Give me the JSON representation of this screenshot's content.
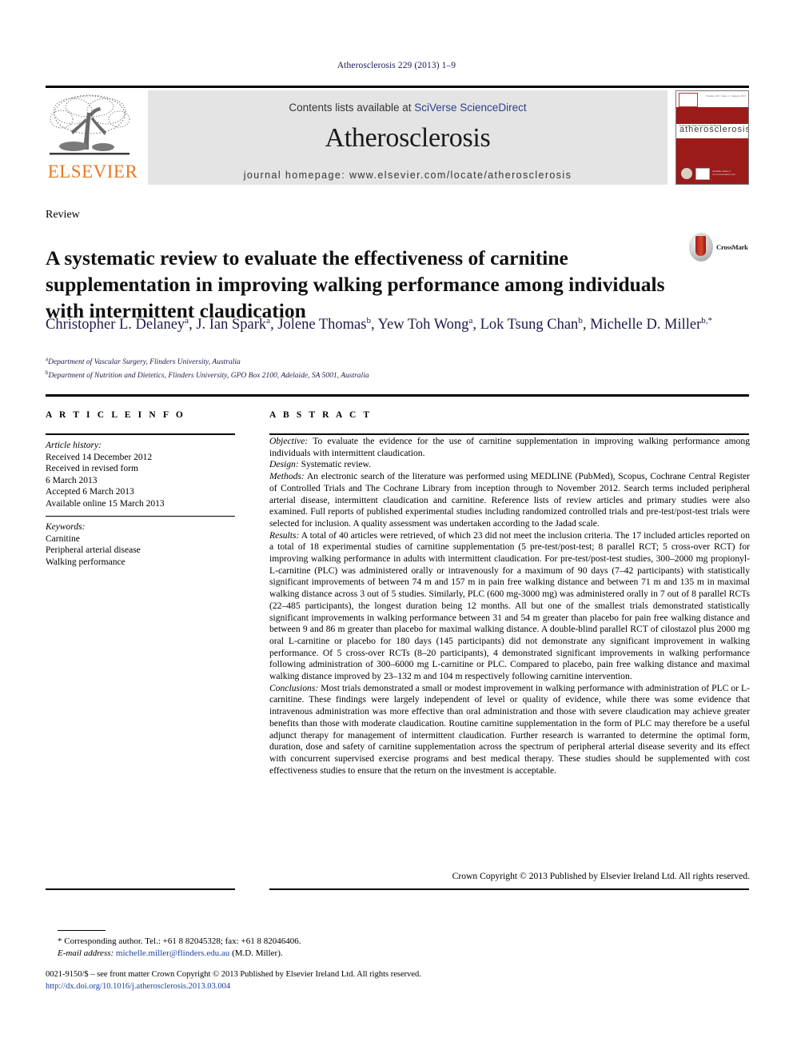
{
  "running_head": "Atherosclerosis 229 (2013) 1–9",
  "masthead": {
    "publisher_logo_text": "ELSEVIER",
    "contents_prefix": "Contents lists available at ",
    "contents_link": "SciVerse ScienceDirect",
    "journal_title": "Atherosclerosis",
    "homepage_label": "journal homepage: www.elsevier.com/locate/atherosclerosis",
    "cover": {
      "title": "atherosclerosis",
      "subtitle": "Editor-in-Chief: Professor Jan Borén",
      "top_note": "Volume 229 • Issue 1 • August 2013",
      "footer_note": "Available online at www.sciencedirect.com"
    }
  },
  "article": {
    "type": "Review",
    "title": "A systematic review to evaluate the effectiveness of carnitine supplementation in improving walking performance among individuals with intermittent claudication",
    "crossmark_label": "CrossMark",
    "authors_html": "Christopher L. Delaney<sup>a</sup>, J. Ian Spark<sup>a</sup>, Jolene Thomas<sup>b</sup>, Yew Toh Wong<sup>a</sup>, Lok Tsung Chan<sup>b</sup>, Michelle D. Miller<sup>b,*</sup>",
    "affiliations": [
      {
        "marker": "a",
        "text": "Department of Vascular Surgery, Flinders University, Australia"
      },
      {
        "marker": "b",
        "text": "Department of Nutrition and Dietetics, Flinders University, GPO Box 2100, Adelaide, SA 5001, Australia"
      }
    ]
  },
  "article_info": {
    "heading": "A R T I C L E  I N F O",
    "history_heading": "Article history:",
    "history_lines": [
      "Received 14 December 2012",
      "Received in revised form",
      "6 March 2013",
      "Accepted 6 March 2013",
      "Available online 15 March 2013"
    ],
    "keywords_heading": "Keywords:",
    "keywords": [
      "Carnitine",
      "Peripheral arterial disease",
      "Walking performance"
    ]
  },
  "abstract": {
    "heading": "A B S T R A C T",
    "sections": [
      {
        "label": "Objective:",
        "text": " To evaluate the evidence for the use of carnitine supplementation in improving walking performance among individuals with intermittent claudication."
      },
      {
        "label": "Design:",
        "text": " Systematic review."
      },
      {
        "label": "Methods:",
        "text": " An electronic search of the literature was performed using MEDLINE (PubMed), Scopus, Cochrane Central Register of Controlled Trials and The Cochrane Library from inception through to November 2012. Search terms included peripheral arterial disease, intermittent claudication and carnitine. Reference lists of review articles and primary studies were also examined. Full reports of published experimental studies including randomized controlled trials and pre-test/post-test trials were selected for inclusion. A quality assessment was undertaken according to the Jadad scale."
      },
      {
        "label": "Results:",
        "text": " A total of 40 articles were retrieved, of which 23 did not meet the inclusion criteria. The 17 included articles reported on a total of 18 experimental studies of carnitine supplementation (5 pre-test/post-test; 8 parallel RCT; 5 cross-over RCT) for improving walking performance in adults with intermittent claudication. For pre-test/post-test studies, 300–2000 mg propionyl-L-carnitine (PLC) was administered orally or intravenously for a maximum of 90 days (7–42 participants) with statistically significant improvements of between 74 m and 157 m in pain free walking distance and between 71 m and 135 m in maximal walking distance across 3 out of 5 studies. Similarly, PLC (600 mg-3000 mg) was administered orally in 7 out of 8 parallel RCTs (22–485 participants), the longest duration being 12 months. All but one of the smallest trials demonstrated statistically significant improvements in walking performance between 31 and 54 m greater than placebo for pain free walking distance and between 9 and 86 m greater than placebo for maximal walking distance. A double-blind parallel RCT of cilostazol plus 2000 mg oral L-carnitine or placebo for 180 days (145 participants) did not demonstrate any significant improvement in walking performance. Of 5 cross-over RCTs (8–20 participants), 4 demonstrated significant improvements in walking performance following administration of 300–6000 mg L-carnitine or PLC. Compared to placebo, pain free walking distance and maximal walking distance improved by 23–132 m and 104 m respectively following carnitine intervention."
      },
      {
        "label": "Conclusions:",
        "text": " Most trials demonstrated a small or modest improvement in walking performance with administration of PLC or L-carnitine. These findings were largely independent of level or quality of evidence, while there was some evidence that intravenous administration was more effective than oral administration and those with severe claudication may achieve greater benefits than those with moderate claudication. Routine carnitine supplementation in the form of PLC may therefore be a useful adjunct therapy for management of intermittent claudication. Further research is warranted to determine the optimal form, duration, dose and safety of carnitine supplementation across the spectrum of peripheral arterial disease severity and its effect with concurrent supervised exercise programs and best medical therapy. These studies should be supplemented with cost effectiveness studies to ensure that the return on the investment is acceptable."
      }
    ],
    "copyright": "Crown Copyright © 2013 Published by Elsevier Ireland Ltd. All rights reserved."
  },
  "footnotes": {
    "corresponding": "* Corresponding author. Tel.: +61 8 82045328; fax: +61 8 82046406.",
    "email_label": "E-mail address:",
    "email": "michelle.miller@flinders.edu.au",
    "email_suffix": "(M.D. Miller).",
    "issn_line": "0021-9150/$ – see front matter Crown Copyright © 2013 Published by Elsevier Ireland Ltd. All rights reserved.",
    "doi": "http://dx.doi.org/10.1016/j.atherosclerosis.2013.03.004"
  }
}
